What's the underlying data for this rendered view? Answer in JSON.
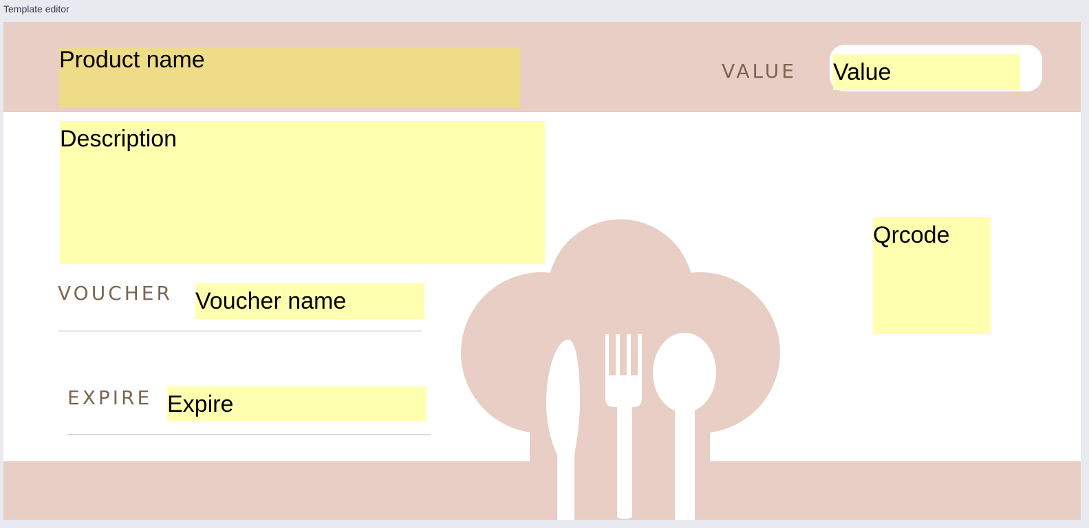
{
  "app": {
    "title": "Template editor"
  },
  "colors": {
    "band": "#e8cec4",
    "field_yellow": "#ffffb0",
    "field_gold": "#eedc88",
    "label_brown": "#7a6652",
    "rule": "#b9b2a6"
  },
  "template": {
    "labels": {
      "value": "VALUE",
      "voucher": "VOUCHER",
      "expire": "EXPIRE"
    },
    "fields": {
      "product_name": "Product name",
      "value": "Value",
      "description": "Description",
      "voucher_name": "Voucher name",
      "qrcode": "Qrcode",
      "expire": "Expire"
    },
    "artwork": {
      "icon": "chef-hat-cutlery-icon"
    }
  }
}
